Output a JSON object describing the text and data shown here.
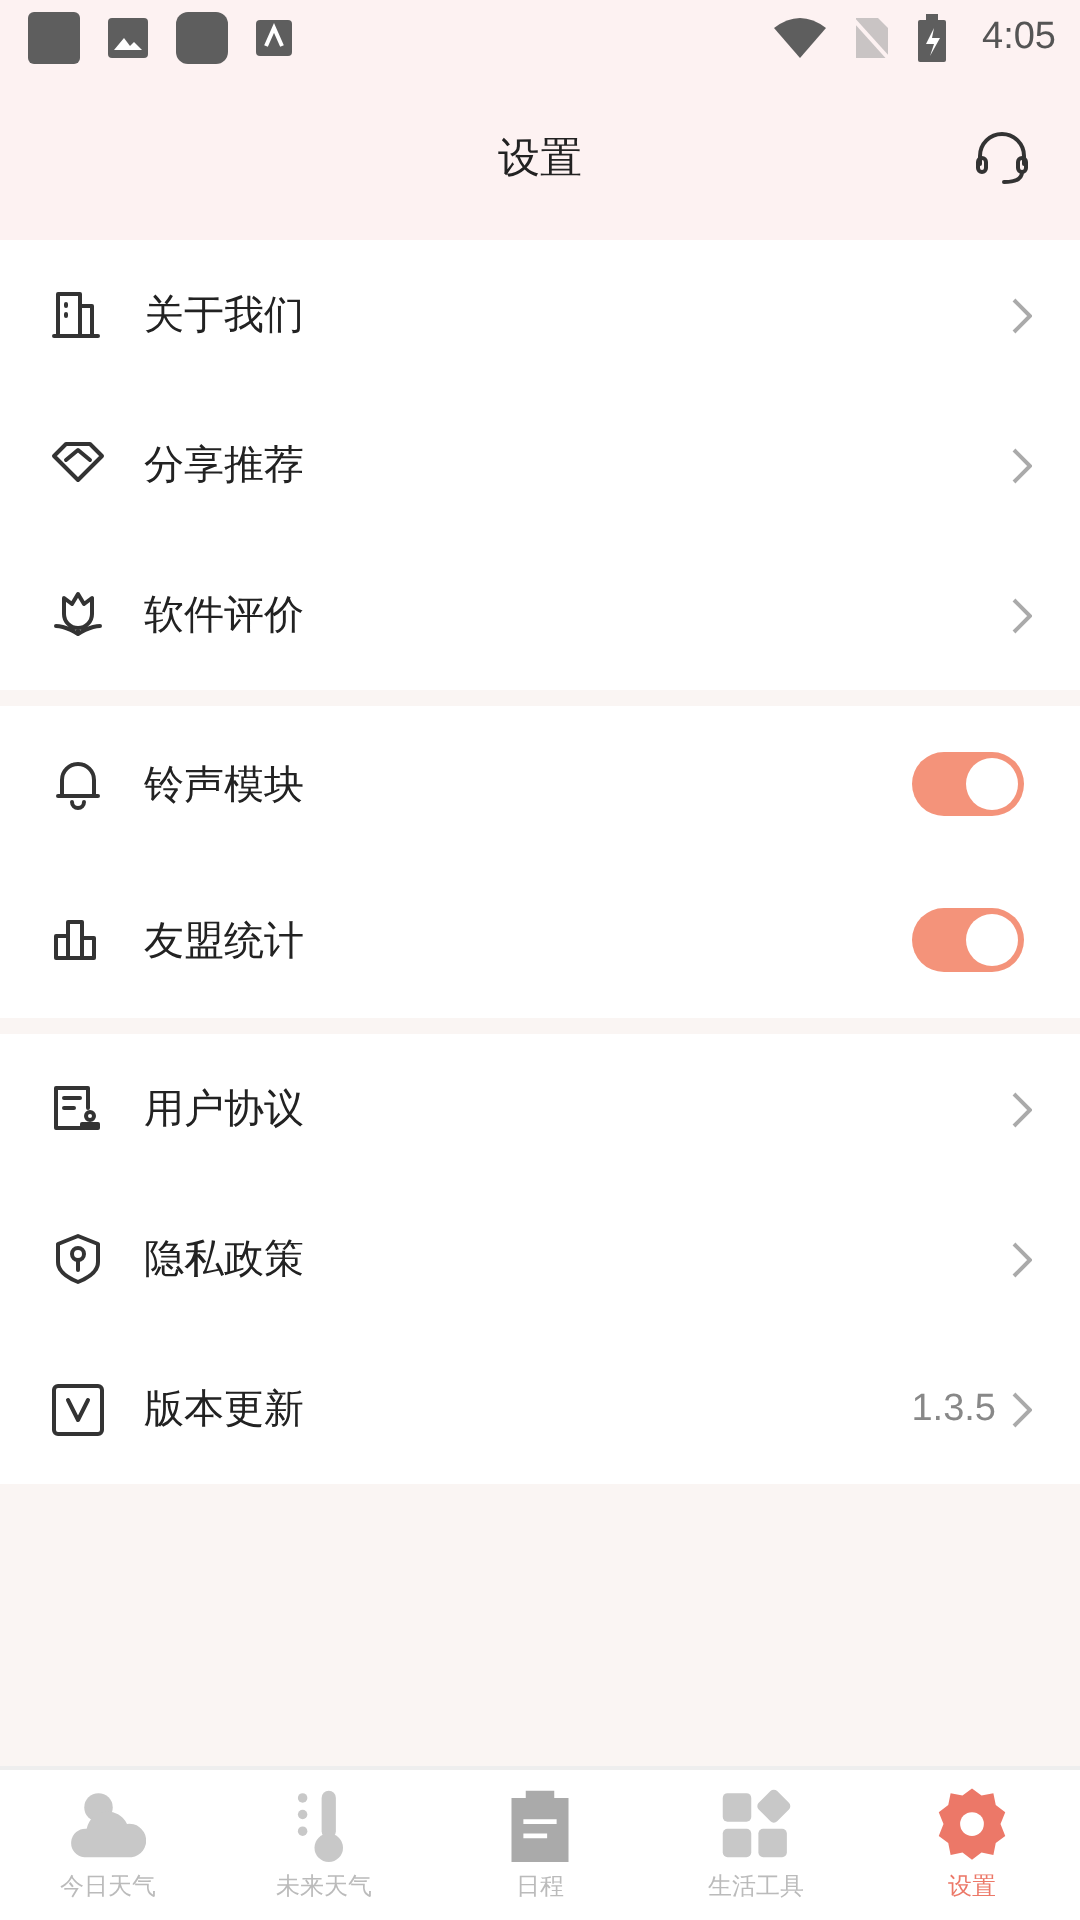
{
  "status_bar": {
    "time": "4:05"
  },
  "header": {
    "title": "设置"
  },
  "groups": [
    {
      "items": [
        {
          "label": "关于我们",
          "kind": "link"
        },
        {
          "label": "分享推荐",
          "kind": "link"
        },
        {
          "label": "软件评价",
          "kind": "link"
        }
      ]
    },
    {
      "items": [
        {
          "label": "铃声模块",
          "kind": "toggle",
          "on": true
        },
        {
          "label": "友盟统计",
          "kind": "toggle",
          "on": true
        }
      ]
    },
    {
      "items": [
        {
          "label": "用户协议",
          "kind": "link"
        },
        {
          "label": "隐私政策",
          "kind": "link"
        },
        {
          "label": "版本更新",
          "kind": "link",
          "value": "1.3.5"
        }
      ]
    }
  ],
  "tab_bar": [
    {
      "label": "今日天气",
      "selected": false
    },
    {
      "label": "未来天气",
      "selected": false
    },
    {
      "label": "日程",
      "selected": false
    },
    {
      "label": "生活工具",
      "selected": false
    },
    {
      "label": "设置",
      "selected": true
    }
  ]
}
